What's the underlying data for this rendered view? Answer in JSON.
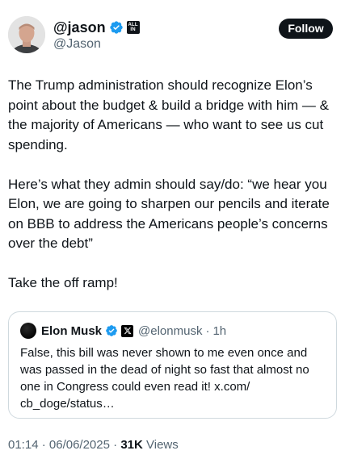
{
  "author": {
    "display_name": "@jason",
    "handle": "@Jason",
    "affiliation_badge": [
      "ALL",
      "IN"
    ],
    "verified_icon": "verified-badge-icon"
  },
  "follow_button": {
    "label": "Follow"
  },
  "tweet": {
    "paragraphs": [
      "The Trump administration should recognize Elon’s point about the budget & build a bridge with him — & the majority of Americans — who want to see us cut spending.",
      "Here’s what they admin should say/do: “we hear you Elon, we are going to sharpen our pencils and iterate on BBB to address the Americans people’s concerns over the debt”",
      "Take the off ramp!"
    ]
  },
  "quoted_tweet": {
    "display_name": "Elon Musk",
    "handle": "@elonmusk",
    "separator": "·",
    "time": "1h",
    "text": "False, this bill was never shown to me even once and was passed in the dead of night so fast that almost no one in Congress could even read it! x.com/\ncb_doge/status…"
  },
  "meta": {
    "time": "01:14",
    "separator": "·",
    "date": "06/06/2025",
    "views_count": "31K",
    "views_label": "Views"
  },
  "colors": {
    "text_primary": "#0f1419",
    "text_secondary": "#536471",
    "verified_blue": "#1d9bf0",
    "border": "#cfd9de"
  }
}
